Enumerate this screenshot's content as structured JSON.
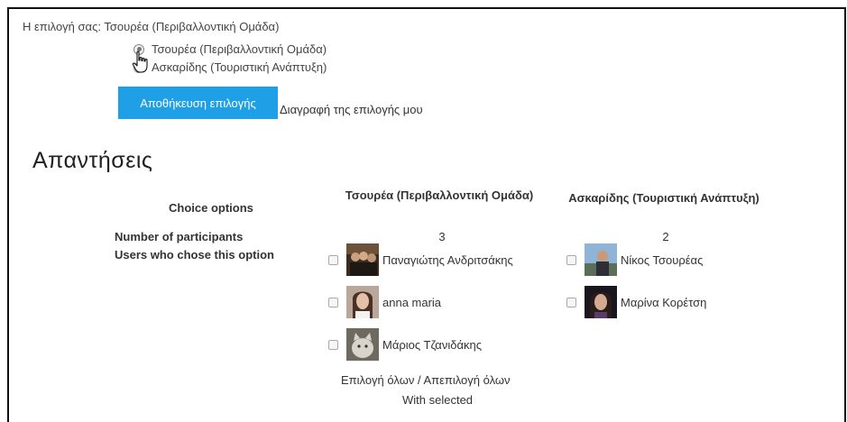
{
  "your_choice": "Η επιλογή σας: Τσουρέα (Περιβαλλοντική Ομάδα)",
  "options": [
    {
      "label": "Τσουρέα (Περιβαλλοντική Ομάδα)",
      "selected": true
    },
    {
      "label": "Ασκαρίδης (Τουριστική Ανάπτυξη)",
      "selected": false
    }
  ],
  "save_button": "Αποθήκευση επιλογής",
  "delete_link": "Διαγραφή της επιλογής μου",
  "responses_title": "Απαντήσεις",
  "table": {
    "choice_options_label": "Choice options",
    "participants_label": "Number of participants",
    "users_label": "Users who chose this option",
    "columns": [
      {
        "header": "Τσουρέα (Περιβαλλοντική Ομάδα)",
        "count": "3",
        "users": [
          "Παναγιώτης Ανδριτσάκης",
          "anna maria",
          "Μάριος Τζανιδάκης"
        ]
      },
      {
        "header": "Ασκαρίδης (Τουριστική Ανάπτυξη)",
        "count": "2",
        "users": [
          "Νίκος Τσουρέας",
          "Μαρίνα Κορέτση"
        ]
      }
    ]
  },
  "select_all": "Επιλογή όλων / Απεπιλογή όλων",
  "with_selected": "With selected",
  "colors": {
    "button": "#1fa0e6",
    "text": "#333333"
  }
}
